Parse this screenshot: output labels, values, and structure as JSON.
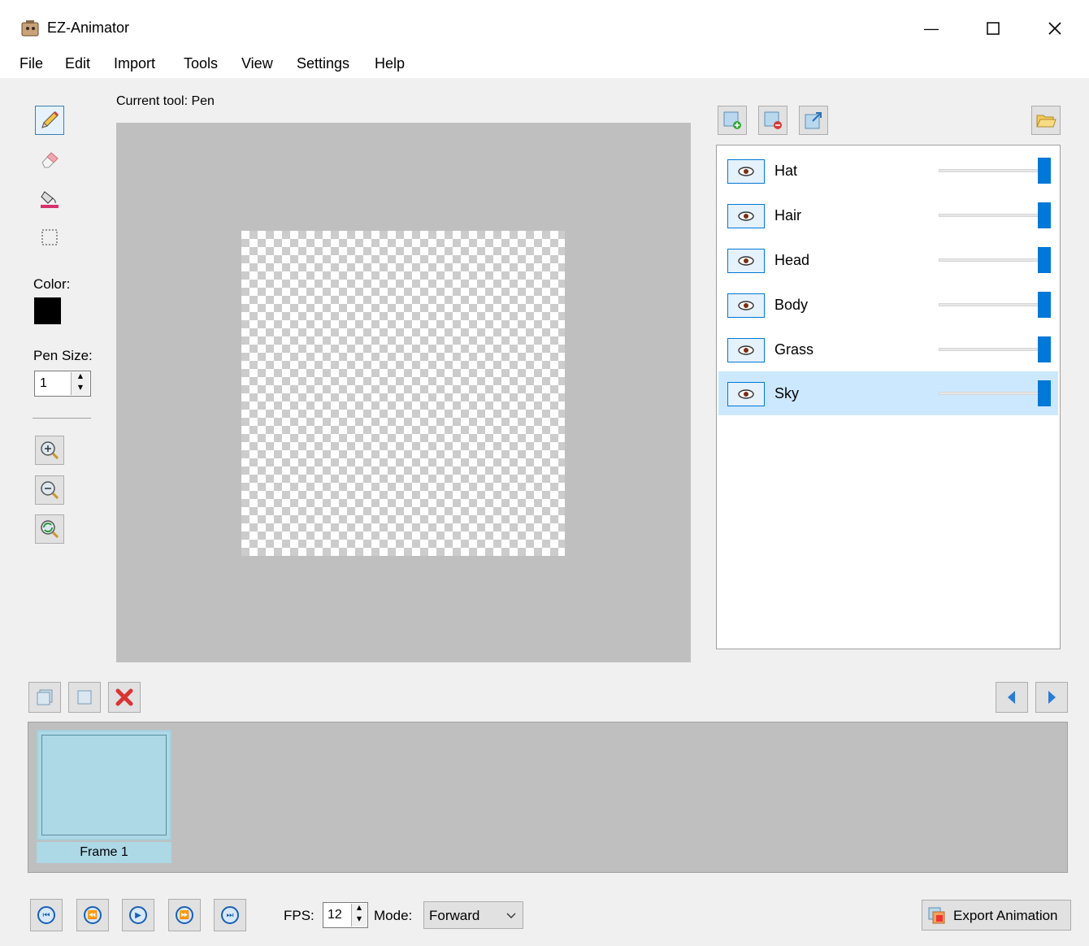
{
  "window": {
    "title": "EZ-Animator",
    "minimize_glyph": "—",
    "maximize_glyph": "☐",
    "close_glyph": "✕"
  },
  "menu": {
    "items": [
      "File",
      "Edit",
      "Import",
      "Tools",
      "View",
      "Settings",
      "Help"
    ]
  },
  "tools": {
    "current_tool_text": "Current tool: Pen",
    "color_label": "Color:",
    "color_value": "#000000",
    "pen_size_label": "Pen Size:",
    "pen_size_value": "1"
  },
  "layers": {
    "items": [
      {
        "name": "Hat",
        "opacity": 1.0
      },
      {
        "name": "Hair",
        "opacity": 1.0
      },
      {
        "name": "Head",
        "opacity": 1.0
      },
      {
        "name": "Body",
        "opacity": 1.0
      },
      {
        "name": "Grass",
        "opacity": 1.0
      },
      {
        "name": "Sky",
        "opacity": 1.0
      }
    ],
    "selected": "Sky"
  },
  "frames": {
    "items": [
      {
        "label": "Frame 1"
      }
    ]
  },
  "playback": {
    "fps_label": "FPS:",
    "fps_value": "12",
    "mode_label": "Mode:",
    "mode_value": "Forward",
    "export_label": "Export Animation"
  },
  "colors": {
    "accent": "#0078d7",
    "canvas_bg": "#bfbfbf",
    "frame_bg": "#add8e6",
    "selected_row": "#cce8ff"
  }
}
